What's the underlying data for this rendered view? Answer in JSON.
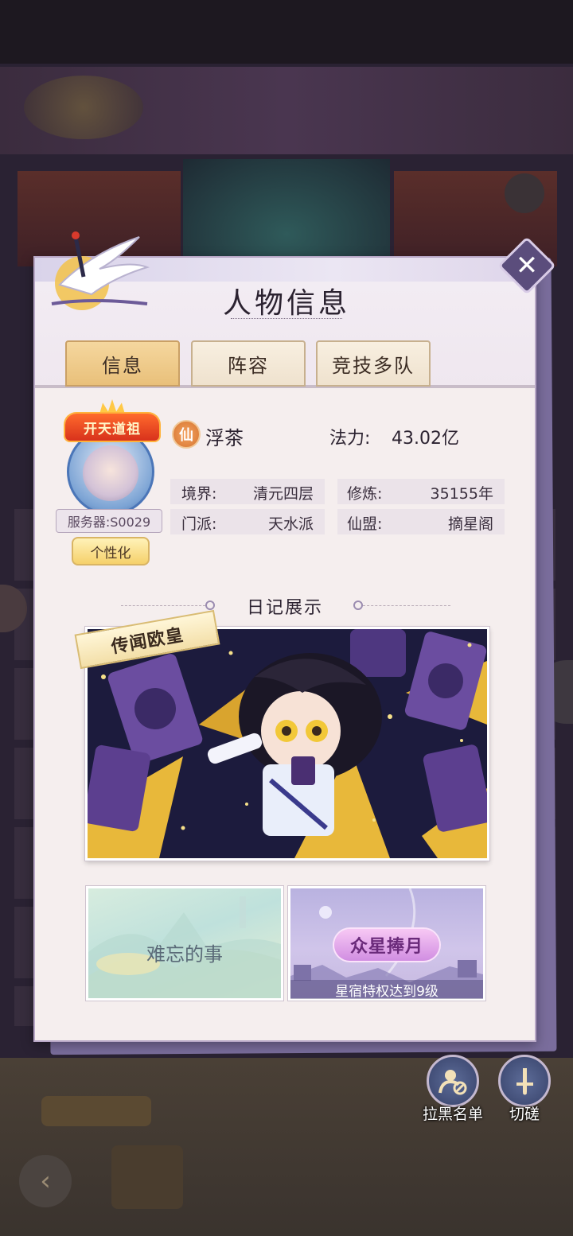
{
  "background": {
    "banner_title": "",
    "banner_subtitle": "",
    "mid_text": "",
    "pill_label": "",
    "back_glyph": "‹"
  },
  "dialog": {
    "title": "人物信息",
    "close_glyph": "✕"
  },
  "tabs": [
    {
      "label": "信息",
      "active": true
    },
    {
      "label": "阵容",
      "active": false
    },
    {
      "label": "竞技多队",
      "active": false
    }
  ],
  "profile": {
    "avatar_title": "开天道祖",
    "server": "服务器:S0029",
    "customize_label": "个性化",
    "faction_badge": "仙",
    "name": "浮茶",
    "power_label": "法力:",
    "power_value": "43.02亿",
    "stats": [
      {
        "label": "境界:",
        "value": "清元四层"
      },
      {
        "label": "修炼:",
        "value": "35155年"
      },
      {
        "label": "门派:",
        "value": "天水派"
      },
      {
        "label": "仙盟:",
        "value": "摘星阁"
      }
    ]
  },
  "diary": {
    "title": "日记展示",
    "featured_ribbon": "传闻欧皇",
    "cards": [
      {
        "title": "难忘的事"
      },
      {
        "badge": "众星捧月",
        "caption": "星宿特权达到9级"
      }
    ]
  },
  "side_actions": [
    {
      "label": "拉黑名单",
      "icon": "block-user-icon"
    },
    {
      "label": "切磋",
      "icon": "sword-icon"
    }
  ],
  "colors": {
    "tab_active": "#e9c07a",
    "panel_bg": "#f5eeee",
    "accent_purple": "#5b4d7c"
  }
}
